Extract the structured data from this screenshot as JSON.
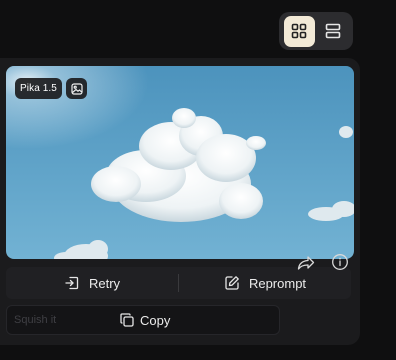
{
  "model_badge": "Pika 1.5",
  "actions": {
    "retry_label": "Retry",
    "reprompt_label": "Reprompt"
  },
  "bottom": {
    "squish_label": "Squish it",
    "copy_label": "Copy"
  },
  "icons": {
    "grid_view": "grid-icon",
    "list_view": "rows-icon",
    "image": "image-icon",
    "retry": "retry-icon",
    "reprompt": "edit-icon",
    "copy": "copy-icon",
    "share": "share-icon",
    "info": "info-icon"
  },
  "colors": {
    "active_toggle": "#f3ead7",
    "card": "#1b1b1d",
    "sky": "#5fa4c8"
  }
}
